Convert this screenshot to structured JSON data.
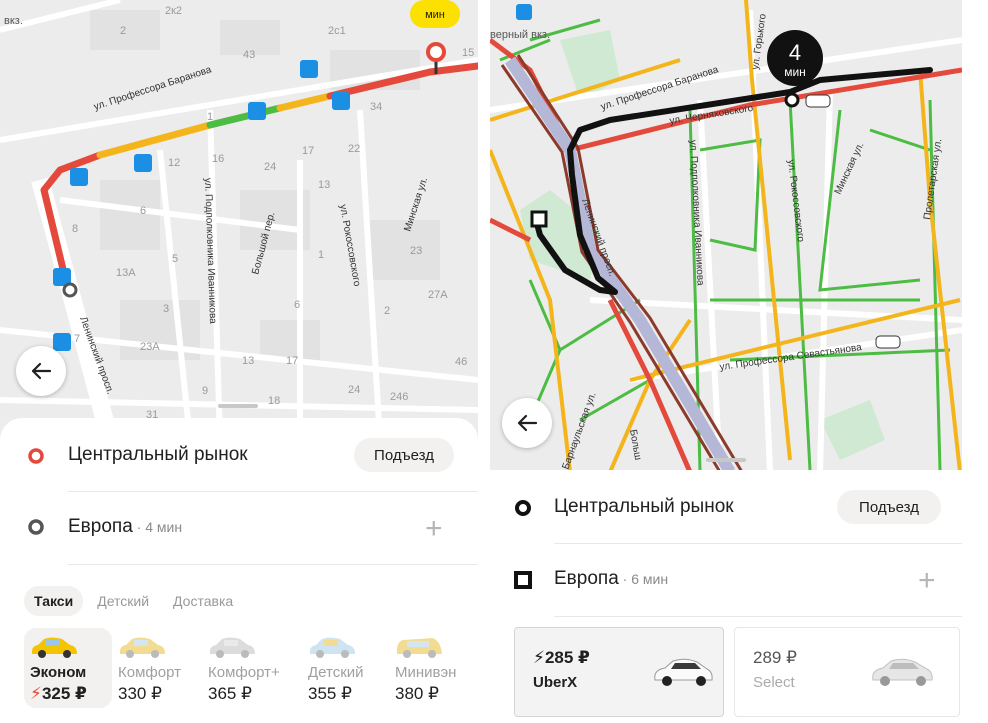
{
  "left": {
    "map": {
      "eta_badge_label": "мин",
      "top_left_label": "вкз.",
      "streets": [
        "ул. Профессора Баранова",
        "ул. Подполковника Иванникова",
        "Большой пер.",
        "ул. Рокоссовского",
        "Минская ул.",
        "Ленинский просп."
      ],
      "house_numbers": [
        "2",
        "2к2",
        "2с1",
        "43",
        "15",
        "1",
        "34",
        "12",
        "16",
        "17",
        "22",
        "24",
        "13",
        "6",
        "5",
        "13А",
        "3",
        "23А",
        "27А",
        "46",
        "13",
        "17",
        "24",
        "246",
        "9",
        "18",
        "31",
        "23",
        "2",
        "1",
        "6",
        "8",
        "7"
      ]
    },
    "route": [
      {
        "icon": "circle-red-icon",
        "title": "Центральный рынок",
        "action": "Подъезд"
      },
      {
        "icon": "circle-dark-icon",
        "title": "Европа",
        "suffix": " · 4 мин",
        "action_icon": "plus-icon"
      }
    ],
    "tabs": [
      "Такси",
      "Детский",
      "Доставка"
    ],
    "active_tab": "Такси",
    "tariffs": [
      {
        "name": "Эконом",
        "price": "325 ₽",
        "surge": true,
        "car_color": "#f5c400"
      },
      {
        "name": "Комфорт",
        "price": "330 ₽",
        "car_color": "#f2dc91"
      },
      {
        "name": "Комфорт+",
        "price": "365 ₽",
        "car_color": "#dcdcdc"
      },
      {
        "name": "Детский",
        "price": "355 ₽",
        "car_color": "#cfe4f2"
      },
      {
        "name": "Минивэн",
        "price": "380 ₽",
        "car_color": "#f2dc91"
      }
    ]
  },
  "right": {
    "map": {
      "eta_badge_value": "4",
      "eta_badge_unit": "мин",
      "top_left_label": "верный вкз.",
      "streets": [
        "ул. Профессора Баранова",
        "ул. Черняховского",
        "ул. Горького",
        "ул. Подполковника Иванникова",
        "ул. Рокоссовского",
        "Минская ул.",
        "Пролетарская ул.",
        "Ленинский просп.",
        "ул. Профессора Севастьянова",
        "Барнаульская ул.",
        "Больш"
      ]
    },
    "route": [
      {
        "icon": "dot-ring-icon",
        "title": "Центральный рынок",
        "action": "Подъезд"
      },
      {
        "icon": "square-stop-icon",
        "title": "Европа",
        "suffix": " · 6 мин",
        "action_icon": "plus-icon"
      }
    ],
    "offers": [
      {
        "price": "285 ₽",
        "name": "UberX",
        "surge": true,
        "selected": true
      },
      {
        "price": "289 ₽",
        "name": "Select",
        "selected": false
      }
    ]
  },
  "colors": {
    "traffic_red": "#e34a3c",
    "traffic_yellow": "#f3b51b",
    "traffic_green": "#4cbc43",
    "route_black": "#111111",
    "transit_blue": "#1a8fe3",
    "park_green": "#cfe9d3"
  }
}
